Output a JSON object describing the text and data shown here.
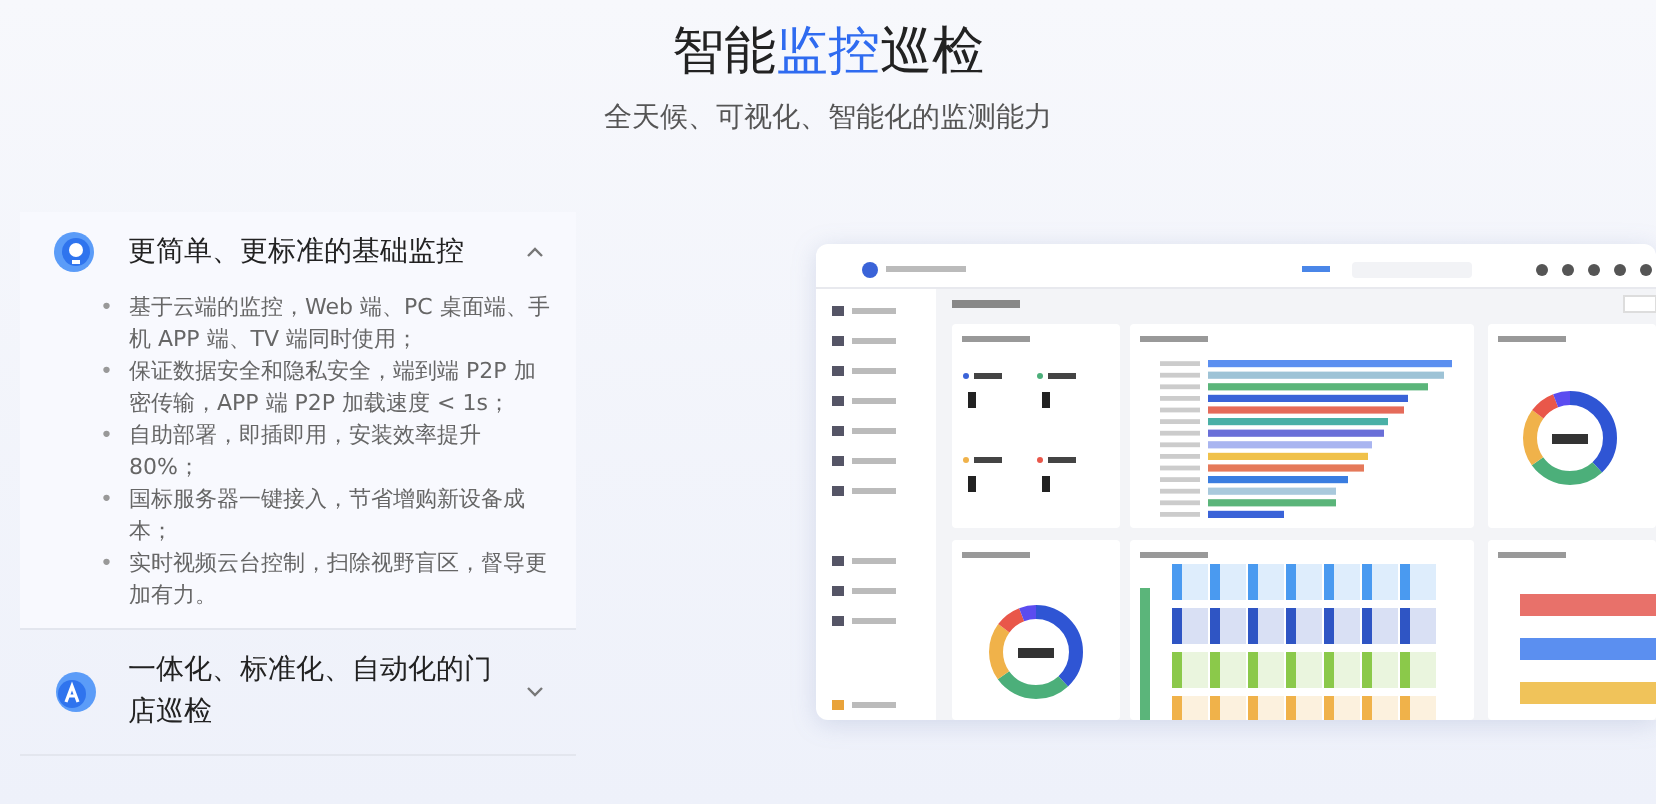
{
  "heading": {
    "parts": [
      {
        "text": "智能",
        "highlight": false
      },
      {
        "text": "监控",
        "highlight": true
      },
      {
        "text": "巡检",
        "highlight": false
      }
    ]
  },
  "subtitle": "全天候、可视化、智能化的监测能力",
  "features": [
    {
      "title": "更简单、更标准的基础监控",
      "expanded": true,
      "kind": "monitor",
      "points": [
        {
          "bullet": "•",
          "text": "基于云端的监控，Web 端、PC 桌面端、手机 APP 端、TV 端同时使用；"
        },
        {
          "bullet": "•",
          "text": "保证数据安全和隐私安全，端到端 P2P 加密传输，APP 端 P2P 加载速度 < 1s；"
        },
        {
          "bullet": "•",
          "text": "自助部署，即插即用，安装效率提升 80%；"
        },
        {
          "bullet": "•",
          "text": "国标服务器一键接入，节省增购新设备成本；"
        },
        {
          "bullet": "•",
          "text": "实时视频云台控制，扫除视野盲区，督导更加有力。"
        }
      ]
    },
    {
      "title": "一体化、标准化、自动化的门店巡检",
      "expanded": false,
      "kind": "robot"
    }
  ]
}
